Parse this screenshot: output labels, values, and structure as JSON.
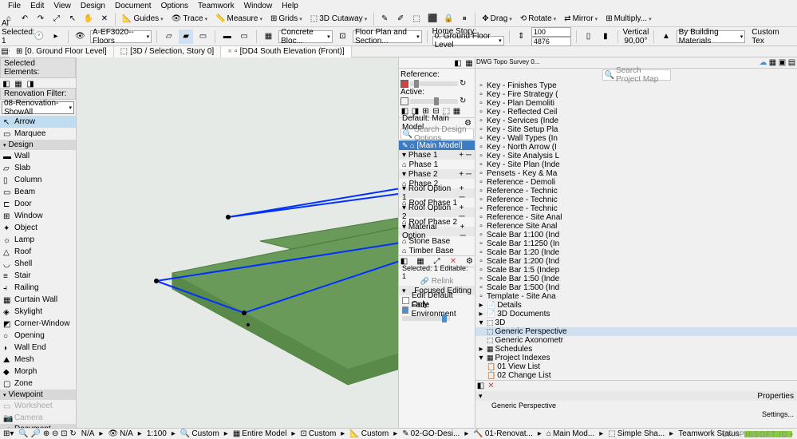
{
  "menu": [
    "File",
    "Edit",
    "View",
    "Design",
    "Document",
    "Options",
    "Teamwork",
    "Window",
    "Help"
  ],
  "toolbar": {
    "guides": "Guides",
    "trace": "Trace",
    "measure": "Measure",
    "grids": "Grids",
    "cutaway": "3D Cutaway",
    "drag": "Drag",
    "rotate": "Rotate",
    "mirror": "Mirror",
    "multiply": "Multiply..."
  },
  "infobar": {
    "selected_hdr": "Al Selected: 1",
    "layer": "A-EF3020--Floors",
    "material": "Concrete Bloc...",
    "plan": "Floor Plan and Section...",
    "home_story_lbl": "Home Story:",
    "home_story": "0. Ground Floor Level",
    "val1": "100",
    "val2": "4876",
    "orient": "Vertical",
    "angle": "90,00°",
    "bymat": "By Building Materials",
    "custom": "Custom Tex"
  },
  "tabs": [
    {
      "label": "[0. Ground Floor Level]"
    },
    {
      "label": "[3D / Selection, Story 0]"
    },
    {
      "label": "[DD4 South Elevation (Front)]",
      "close": true
    }
  ],
  "left": {
    "sel_hdr": "Selected Elements:",
    "reno_hdr": "Renovation Filter:",
    "reno": "08-Renovation-ShowAll",
    "tools_design": [
      "Arrow",
      "Marquee"
    ],
    "design_hdr": "Design",
    "design": [
      "Wall",
      "Slab",
      "Column",
      "Beam",
      "Door",
      "Window",
      "Object",
      "Lamp",
      "Roof",
      "Shell",
      "Stair",
      "Railing",
      "Curtain Wall",
      "Skylight",
      "Corner-Window",
      "Opening",
      "Wall End",
      "Mesh",
      "Morph",
      "Zone"
    ],
    "viewpoint_hdr": "Viewpoint",
    "viewpoint": [
      "Worksheet",
      "Camera"
    ],
    "doc_hdr": "Document"
  },
  "trace": {
    "ref": "Reference:",
    "active": "Active:"
  },
  "design_options": {
    "default": "Default: Main Model",
    "search": "Search Design Options",
    "main": "[Main Model]",
    "groups": [
      {
        "h": "Phase 1",
        "items": [
          "Phase 1"
        ]
      },
      {
        "h": "Phase 2",
        "items": [
          "Phase 2"
        ]
      },
      {
        "h": "Roof Option 1",
        "items": [
          "Roof Phase 1"
        ]
      },
      {
        "h": "Roof Option 2",
        "items": [
          "Roof Phase 2"
        ]
      },
      {
        "h": "Material Option",
        "items": [
          "Stone Base",
          "Timber Base"
        ]
      }
    ],
    "sel": "Selected: 1 Editable: 1",
    "relink": "Relink",
    "focused": "Focused Editing",
    "editdef": "Edit Default Only",
    "fade": "Fade Environment"
  },
  "nav": {
    "title": "DWG Topo Survey 0...",
    "search": "Search Project Map",
    "items": [
      "Key -  Finishes Type",
      "Key -  Fire Strategy (",
      "Key -  Plan Demoliti",
      "Key -  Reflected Ceil",
      "Key -  Services (Inde",
      "Key -  Site Setup Pla",
      "Key -  Wall Types (In",
      "Key - North Arrow (I",
      "Key - Site Analysis L",
      "Key - Site Plan (Inde",
      "Pensets -  Key & Ma",
      "Reference -  Demoli",
      "Reference -  Technic",
      "Reference -  Technic",
      "Reference -  Technic",
      "Reference - Site Anal",
      "Reference Site Anal",
      "Scale Bar 1:100 (Ind",
      "Scale Bar 1:1250 (In",
      "Scale Bar 1:20 (Inde",
      "Scale Bar 1:200 (Ind",
      "Scale Bar 1:5 (Indep",
      "Scale Bar 1:50 (Inde",
      "Scale Bar 1:500 (Ind",
      "Template - Site Ana"
    ],
    "details": "Details",
    "3ddoc": "3D Documents",
    "3d": "3D",
    "persp": "Generic Perspective",
    "axo": "Generic Axonometr",
    "sched": "Schedules",
    "proj": "Project Indexes",
    "viewlist": "01 View List",
    "changelist": "02 Change List",
    "props": "Properties",
    "persp2": "Generic Perspective",
    "settings": "Settings..."
  },
  "status": {
    "na": "N/A",
    "ratio": "1:100",
    "custom": "Custom",
    "entire": "Entire Model",
    "go": "02-GO-Desi...",
    "reno": "01-Renovat...",
    "main": "Main Mod...",
    "simple": "Simple Sha...",
    "tw": "Teamwork Status"
  }
}
